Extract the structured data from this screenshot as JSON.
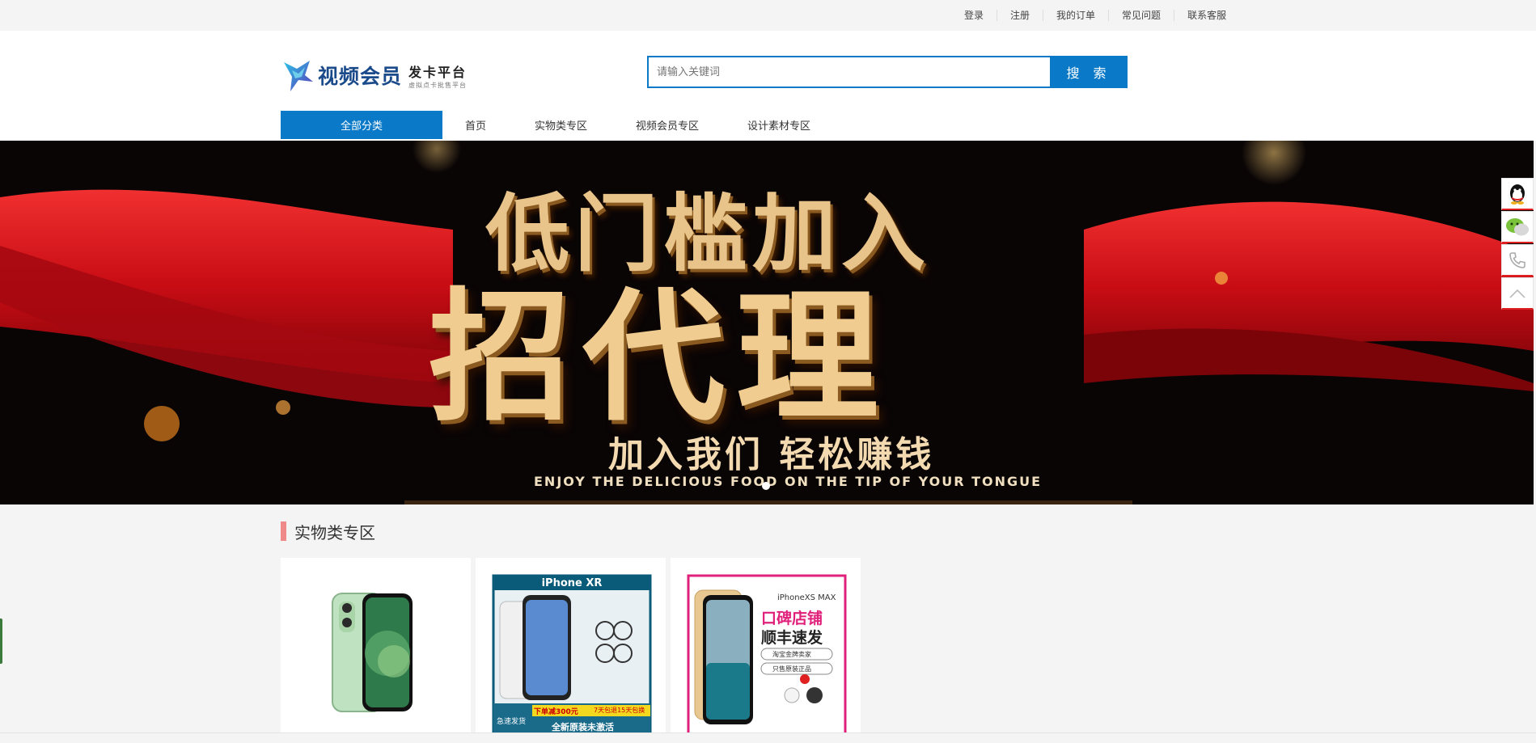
{
  "topbar": {
    "links": [
      "登录",
      "注册",
      "我的订单",
      "常见问题",
      "联系客服"
    ]
  },
  "logo": {
    "brand": "视频会员",
    "sub_title": "发卡平台",
    "sub_caption": "虚拟点卡批售平台"
  },
  "search": {
    "placeholder": "请输入关键词",
    "button_label": "搜 索"
  },
  "nav": {
    "all_categories": "全部分类",
    "items": [
      "首页",
      "实物类专区",
      "视频会员专区",
      "设计素材专区"
    ]
  },
  "banner": {
    "headline_1": "低门槛加入",
    "headline_2": "招代理",
    "slogan": "加入我们 轻松赚钱",
    "english": "ENJOY THE DELICIOUS FOOD ON THE TIP OF YOUR TONGUE"
  },
  "side_float": {
    "icons": [
      "qq-icon",
      "wechat-icon",
      "phone-icon",
      "back-to-top-icon"
    ]
  },
  "section": {
    "title": "实物类专区"
  },
  "products": [
    {
      "image": "iphone-12-green"
    },
    {
      "image": "iphone-xr-ad",
      "title": "iPhone XR",
      "promo_1": "下单减300元",
      "promo_2": "7天包退15天包换",
      "promo_3": "全新原装未激活",
      "tag": "急速发货"
    },
    {
      "image": "iphone-xs-max-ad",
      "title": "iPhoneXS MAX",
      "promo_1": "口碑店铺",
      "promo_2": "顺丰速发",
      "badge_1": "淘宝金牌卖家",
      "badge_2": "只售原装正品"
    }
  ],
  "colors": {
    "accent": "#0a7ac8",
    "section_bar": "#f08a8a",
    "banner_red": "#d4121a",
    "banner_gold": "#e8c48a"
  }
}
